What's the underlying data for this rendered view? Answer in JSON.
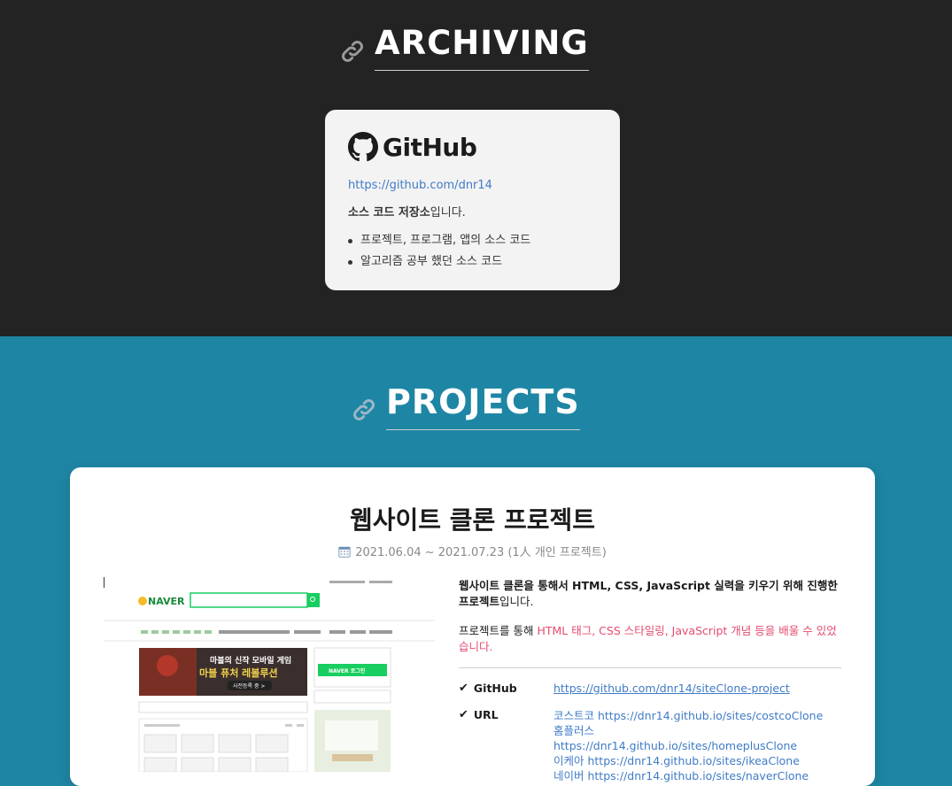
{
  "archiving": {
    "title": "ARCHIVING",
    "github": {
      "logo_text": "GitHub",
      "url": "https://github.com/dnr14",
      "desc_bold": "소스 코드 저장소",
      "desc_rest": "입니다.",
      "items": [
        "프로젝트, 프로그램, 앱의 소스 코드",
        "알고리즘 공부 했던 소스 코드"
      ]
    }
  },
  "projects": {
    "title": "PROJECTS",
    "card": {
      "title": "웹사이트 클론 프로젝트",
      "date": "2021.06.04 ~ 2021.07.23 (1人 개인 프로젝트)",
      "lead_bold": "웹사이트 클론을 통해서 HTML, CSS, JavaScript 실력을 키우기 위해 진행한 프로젝트",
      "lead_rest": "입니다.",
      "sub_prefix": "프로젝트를 통해 ",
      "sub_highlight": "HTML 태그, CSS 스타일링, JavaScript 개념 등을 배울 수 있었습니다.",
      "github_label": "GitHub",
      "github_url": "https://github.com/dnr14/siteClone-project",
      "url_label": "URL",
      "urls": [
        {
          "name": "코스트코",
          "url": "https://dnr14.github.io/sites/costcoClone"
        },
        {
          "name": "홈플러스",
          "url": "https://dnr14.github.io/sites/homeplusClone"
        },
        {
          "name": "이케아",
          "url": "https://dnr14.github.io/sites/ikeaClone"
        },
        {
          "name": "네이버",
          "url": "https://dnr14.github.io/sites/naverClone"
        }
      ],
      "screenshot": {
        "logo": "NAVER",
        "banner_line1": "마블의 신작 모바일 게임",
        "banner_line2": "마블 퓨처 레볼루션",
        "banner_button": "사전등록 중 >",
        "login_button": "NAVER 로그인"
      }
    }
  },
  "colors": {
    "dark_bg": "#232323",
    "teal_bg": "#1e86a4",
    "link": "#3f7bc6",
    "highlight": "#e44b6f",
    "naver_green": "#19ce60"
  }
}
